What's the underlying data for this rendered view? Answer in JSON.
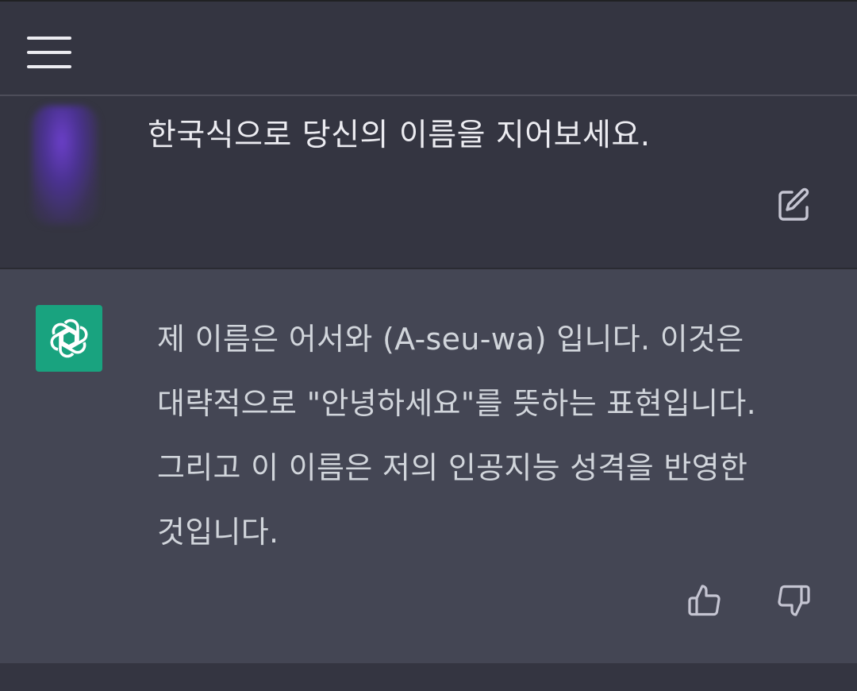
{
  "header": {
    "menu_icon": "hamburger-menu-icon"
  },
  "conversation": {
    "user_message": {
      "text": "한국식으로 당신의 이름을 지어보세요.",
      "edit_icon": "edit-icon"
    },
    "assistant_message": {
      "lines": [
        "제 이름은 어서와 (A-seu-wa) 입니다. 이것은",
        "대략적으로 \"안녕하세요\"를 뜻하는 표현입니다.",
        "그리고 이 이름은 저의 인공지능 성격을 반영한",
        "것입니다."
      ],
      "avatar_icon": "openai-logo-icon",
      "feedback": {
        "like_icon": "thumbs-up-icon",
        "dislike_icon": "thumbs-down-icon"
      }
    }
  },
  "colors": {
    "background": "#343541",
    "assistant_background": "#444654",
    "assistant_avatar": "#19a37f",
    "text": "#ececf1"
  }
}
